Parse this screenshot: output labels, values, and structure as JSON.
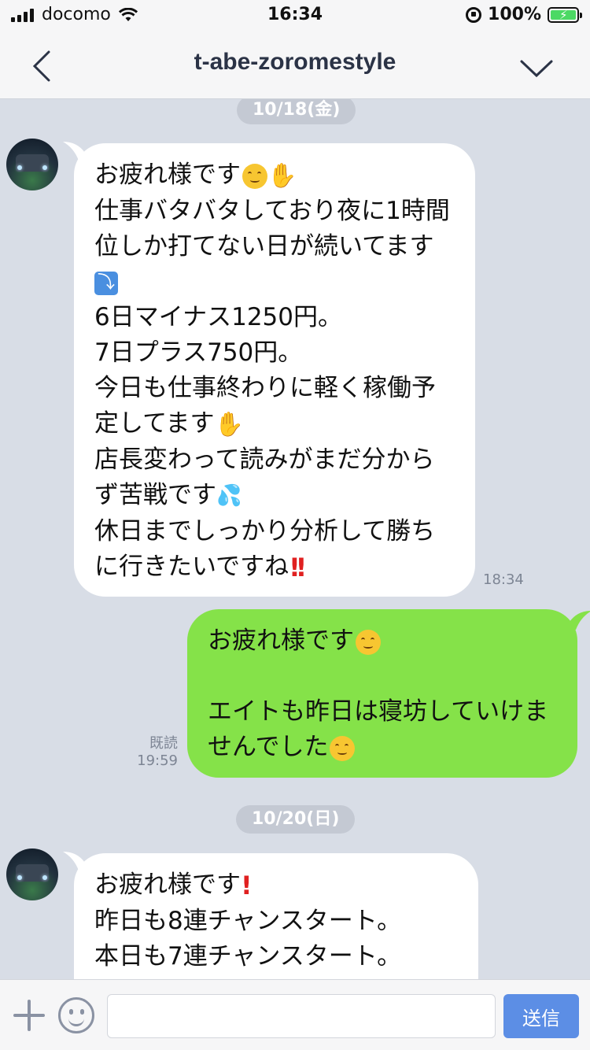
{
  "status_bar": {
    "carrier": "docomo",
    "time": "16:34",
    "battery_text": "100%",
    "battery_level": 1.0
  },
  "header": {
    "title": "t-abe-zoromestyle",
    "back_icon": "chevron-left-icon",
    "menu_icon": "chevron-down-icon"
  },
  "messages": {
    "date1": "10/18(金)",
    "msg1": {
      "lines": [
        "お疲れ様です",
        "仕事バタバタしており夜に1時間",
        "位しか打てない日が続いてます",
        "",
        "6日マイナス1250円。",
        "7日プラス750円。",
        "今日も仕事終わりに軽く稼働予",
        "定してます",
        "店長変わって読みがまだ分から",
        "ず苦戦です",
        "休日までしっかり分析して勝ち",
        "に行きたいですね"
      ],
      "time": "18:34"
    },
    "msg2": {
      "lines": [
        "お疲れ様です",
        "",
        "エイトも昨日は寝坊していけま",
        "せんでした"
      ],
      "read_label": "既読",
      "time": "19:59"
    },
    "date2": "10/20(日)",
    "msg3": {
      "lines": [
        "お疲れ様です",
        "昨日も8連チャンスタート。",
        "本日も7連チャンスタート。"
      ]
    }
  },
  "input_bar": {
    "placeholder": "",
    "send_label": "送信"
  },
  "colors": {
    "chat_bg": "#d8dde6",
    "incoming_bubble": "#ffffff",
    "outgoing_bubble": "#85e249",
    "send_button": "#5c8ee5"
  }
}
